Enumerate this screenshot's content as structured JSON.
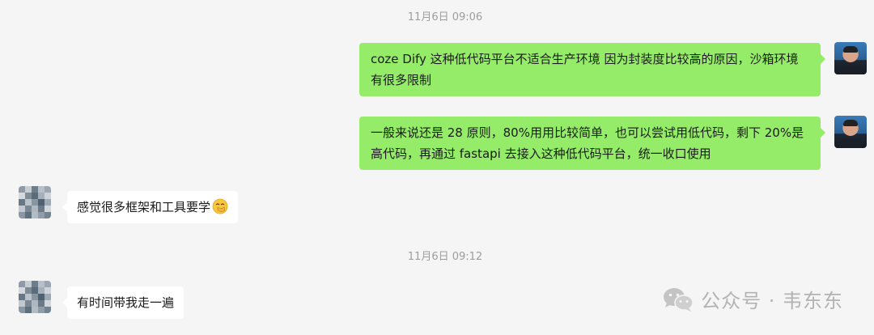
{
  "chat": {
    "time_1": "11月6日 09:06",
    "time_2": "11月6日 09:12",
    "messages": [
      {
        "sender": "self",
        "text": "coze Dify 这种低代码平台不适合生产环境 因为封装度比较高的原因，沙箱环境有很多限制"
      },
      {
        "sender": "self",
        "text": "一般来说还是 28 原则，80%用用比较简单，也可以尝试用低代码，剩下 20%是高代码，再通过 fastapi 去接入这种低代码平台，统一收口使用"
      },
      {
        "sender": "other",
        "text": "感觉很多框架和工具要学",
        "emoji": "face-with-hand-over-mouth-emoji"
      },
      {
        "sender": "other",
        "text": "有时间带我走一遍"
      }
    ]
  },
  "watermark": {
    "text": "公众号 · 韦东东",
    "icon": "wechat-logo-icon"
  },
  "colors": {
    "background": "#f5f5f5",
    "self_bubble": "#95ec69",
    "other_bubble": "#ffffff",
    "timestamp": "#9d9d9d"
  }
}
